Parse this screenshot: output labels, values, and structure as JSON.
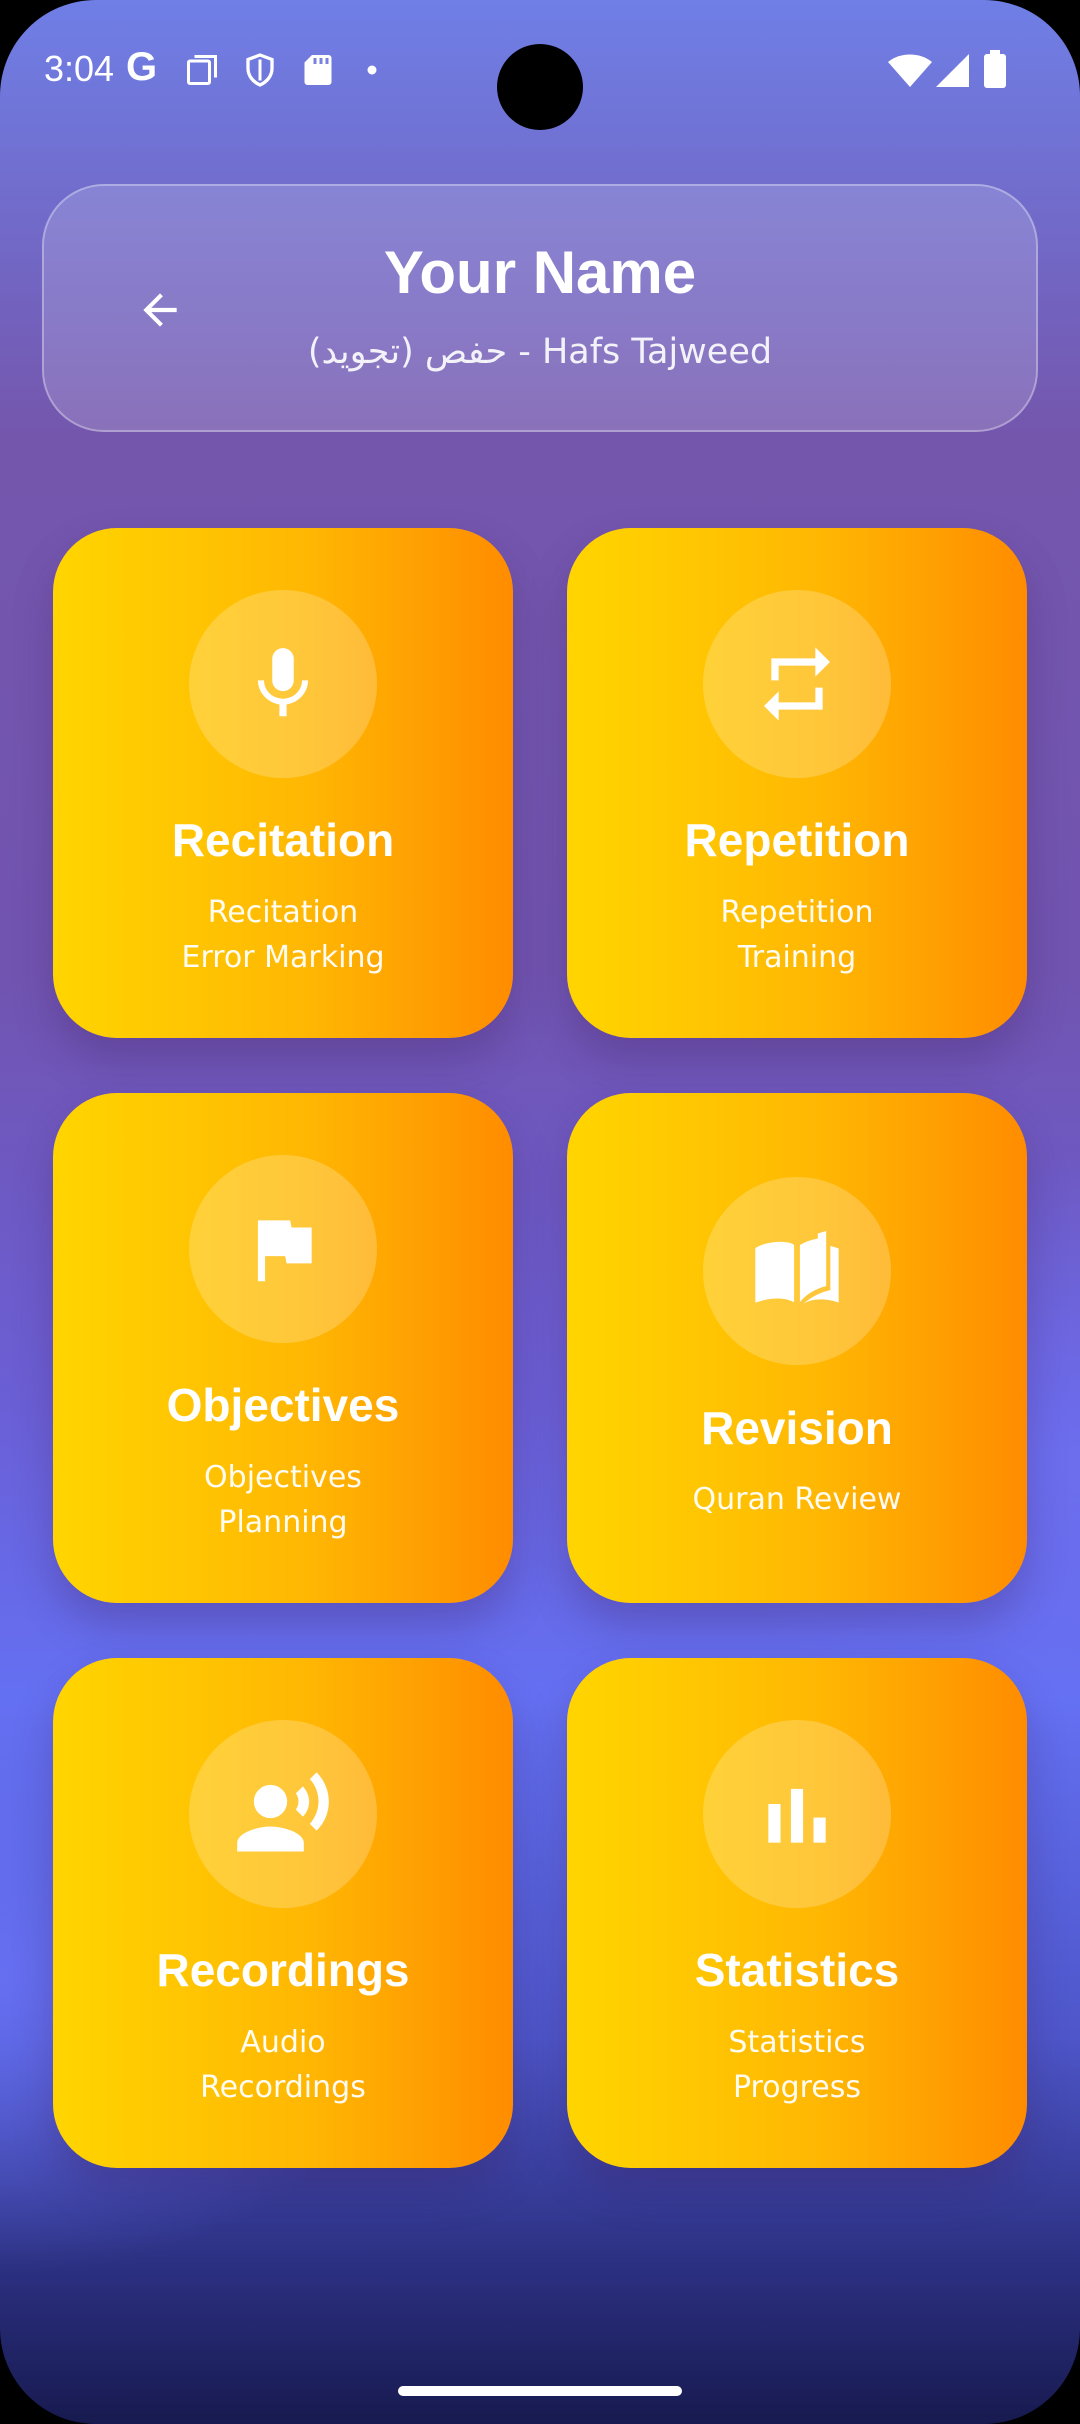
{
  "status_bar": {
    "time": "3:04",
    "google_letter": "G",
    "icons": [
      "google-icon",
      "screenshot-icon",
      "shield-icon",
      "sd-card-icon",
      "dot-icon",
      "wifi-icon",
      "signal-icon",
      "battery-icon"
    ]
  },
  "header": {
    "title": "Your Name",
    "subtitle": "حفص (تجويد) - Hafs Tajweed",
    "back_icon": "arrow-left-icon"
  },
  "tiles": [
    {
      "title": "Recitation",
      "desc_line1": "Recitation",
      "desc_line2": "Error Marking",
      "icon": "microphone-icon"
    },
    {
      "title": "Repetition",
      "desc_line1": "Repetition",
      "desc_line2": "Training",
      "icon": "repeat-icon"
    },
    {
      "title": "Objectives",
      "desc_line1": "Objectives",
      "desc_line2": "Planning",
      "icon": "flag-icon"
    },
    {
      "title": "Revision",
      "desc_line1": "Quran Review",
      "icon": "book-icon"
    },
    {
      "title": "Recordings",
      "desc_line1": "Audio",
      "desc_line2": "Recordings",
      "icon": "record-voice-icon"
    },
    {
      "title": "Statistics",
      "desc_line1": "Statistics",
      "desc_line2": "Progress",
      "icon": "bar-chart-icon"
    }
  ],
  "colors": {
    "tile_gradient_start": "#ffd500",
    "tile_gradient_end": "#ff8c00",
    "background_top": "#6f7fe6",
    "background_bottom": "#171a4f"
  }
}
